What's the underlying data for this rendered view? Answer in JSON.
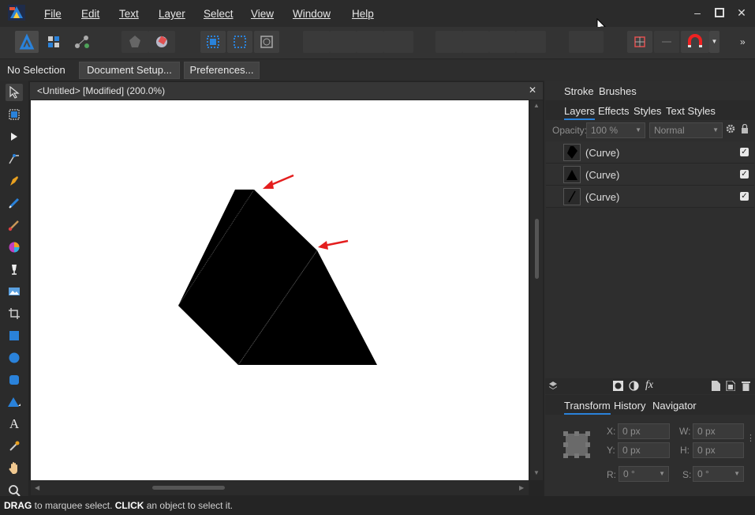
{
  "menu": [
    "File",
    "Edit",
    "Text",
    "Layer",
    "Select",
    "View",
    "Window",
    "Help"
  ],
  "context": {
    "selection": "No Selection",
    "document_setup": "Document Setup...",
    "preferences": "Preferences..."
  },
  "document": {
    "tab_title": "<Untitled> [Modified] (200.0%)"
  },
  "panels": {
    "top_tabs": [
      "Stroke",
      "Brushes"
    ],
    "mid_tabs": [
      "Layers",
      "Effects",
      "Styles",
      "Text Styles"
    ],
    "opacity_label": "Opacity:",
    "opacity_value": "100 %",
    "blend_mode": "Normal",
    "layers": [
      {
        "name": "(Curve)",
        "visible": true
      },
      {
        "name": "(Curve)",
        "visible": true
      },
      {
        "name": "(Curve)",
        "visible": true
      }
    ],
    "fx_label": "fx",
    "bottom_tabs": [
      "Transform",
      "History",
      "Navigator"
    ],
    "transform": {
      "x_label": "X:",
      "x": "0 px",
      "y_label": "Y:",
      "y": "0 px",
      "w_label": "W:",
      "w": "0 px",
      "h_label": "H:",
      "h": "0 px",
      "r_label": "R:",
      "r": "0 °",
      "s_label": "S:",
      "s": "0 °"
    }
  },
  "status": {
    "drag": "DRAG",
    "drag_text": " to marquee select. ",
    "click": "CLICK",
    "click_text": " an object to select it."
  },
  "colors": {
    "accent": "#2a82da",
    "arrow": "#e41e1e"
  },
  "icons": [
    "close-icon",
    "settings-icon",
    "lock-icon",
    "layers-icon",
    "mask-icon",
    "adjustment-icon",
    "add-page-icon",
    "delete-icon"
  ]
}
